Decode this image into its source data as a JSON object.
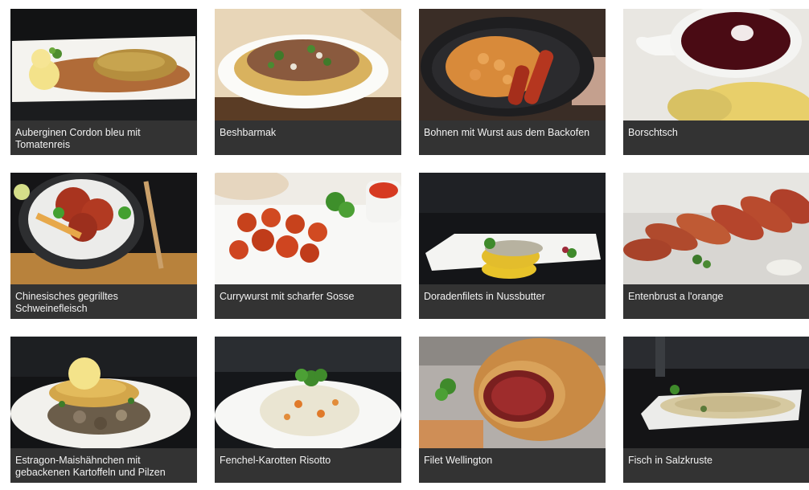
{
  "recipes": [
    {
      "title": "Auberginen Cordon bleu mit Tomatenreis",
      "image": "eggplant-cordon-bleu-photo"
    },
    {
      "title": "Beshbarmak",
      "image": "beshbarmak-photo"
    },
    {
      "title": "Bohnen mit Wurst aus dem Backofen",
      "image": "beans-sausage-pan-photo"
    },
    {
      "title": "Borschtsch",
      "image": "borscht-photo"
    },
    {
      "title": "Chinesisches gegrilltes Schweinefleisch",
      "image": "grilled-pork-bowl-photo"
    },
    {
      "title": "Currywurst mit scharfer Sosse",
      "image": "currywurst-photo"
    },
    {
      "title": "Doradenfilets in Nussbutter",
      "image": "dorade-fillet-photo"
    },
    {
      "title": "Entenbrust a l'orange",
      "image": "duck-breast-photo"
    },
    {
      "title": "Estragon-Maishähnchen mit gebackenen Kartoffeln und Pilzen",
      "image": "tarragon-chicken-photo"
    },
    {
      "title": "Fenchel-Karotten Risotto",
      "image": "fennel-risotto-photo"
    },
    {
      "title": "Filet Wellington",
      "image": "filet-wellington-photo"
    },
    {
      "title": "Fisch in Salzkruste",
      "image": "salt-crusted-fish-photo"
    }
  ]
}
